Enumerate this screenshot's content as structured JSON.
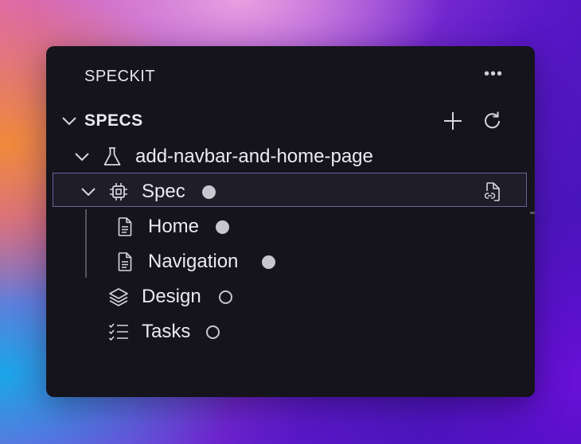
{
  "panel": {
    "title": "SPECKIT",
    "more_icon": "ellipsis-icon"
  },
  "section": {
    "label": "SPECS",
    "add_icon": "plus-icon",
    "refresh_icon": "refresh-icon"
  },
  "tree": {
    "project": {
      "label": "add-navbar-and-home-page",
      "icon": "beaker-icon"
    },
    "spec": {
      "label": "Spec",
      "icon": "chip-icon",
      "status": "filled",
      "action_icon": "file-link-icon"
    },
    "spec_children": [
      {
        "label": "Home",
        "icon": "document-icon",
        "status": "filled"
      },
      {
        "label": "Navigation",
        "icon": "document-icon",
        "status": "filled"
      }
    ],
    "design": {
      "label": "Design",
      "icon": "layers-icon",
      "status": "empty"
    },
    "tasks": {
      "label": "Tasks",
      "icon": "checklist-icon",
      "status": "empty"
    }
  },
  "colors": {
    "panel_bg": "#15141c",
    "selection_border": "#6b6399",
    "status_dot": "#c8c6cf"
  }
}
